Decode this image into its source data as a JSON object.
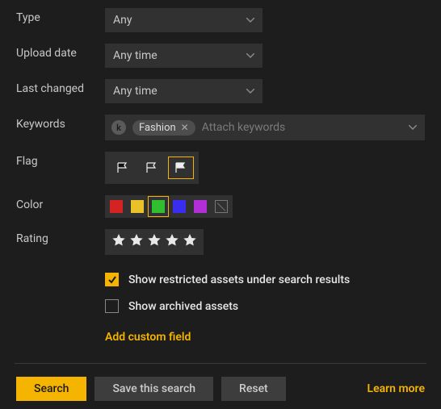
{
  "filters": {
    "type": {
      "label": "Type",
      "value": "Any"
    },
    "upload_date": {
      "label": "Upload date",
      "value": "Any time"
    },
    "last_changed": {
      "label": "Last changed",
      "value": "Any time"
    },
    "keywords": {
      "label": "Keywords",
      "badge": "k",
      "tags": [
        {
          "text": "Fashion"
        }
      ],
      "placeholder": "Attach keywords"
    },
    "flag": {
      "label": "Flag",
      "options": [
        {
          "name": "flag-black",
          "active": false
        },
        {
          "name": "flag-outline",
          "active": false
        },
        {
          "name": "flag-white",
          "active": true
        }
      ]
    },
    "color": {
      "label": "Color",
      "swatches": [
        {
          "name": "red",
          "hex": "#d62222",
          "active": false
        },
        {
          "name": "yellow",
          "hex": "#e9c22a",
          "active": false
        },
        {
          "name": "green",
          "hex": "#2fbf2f",
          "active": true
        },
        {
          "name": "blue",
          "hex": "#3a2df0",
          "active": false
        },
        {
          "name": "purple",
          "hex": "#b22fd6",
          "active": false
        },
        {
          "name": "none",
          "hex": null,
          "active": false
        }
      ]
    },
    "rating": {
      "label": "Rating",
      "stars": 5
    }
  },
  "options": {
    "restricted": {
      "checked": true,
      "label": "Show restricted assets under search results"
    },
    "archived": {
      "checked": false,
      "label": "Show archived assets"
    },
    "add_custom": "Add custom field"
  },
  "footer": {
    "search": "Search",
    "save": "Save this search",
    "reset": "Reset",
    "learn": "Learn more"
  }
}
